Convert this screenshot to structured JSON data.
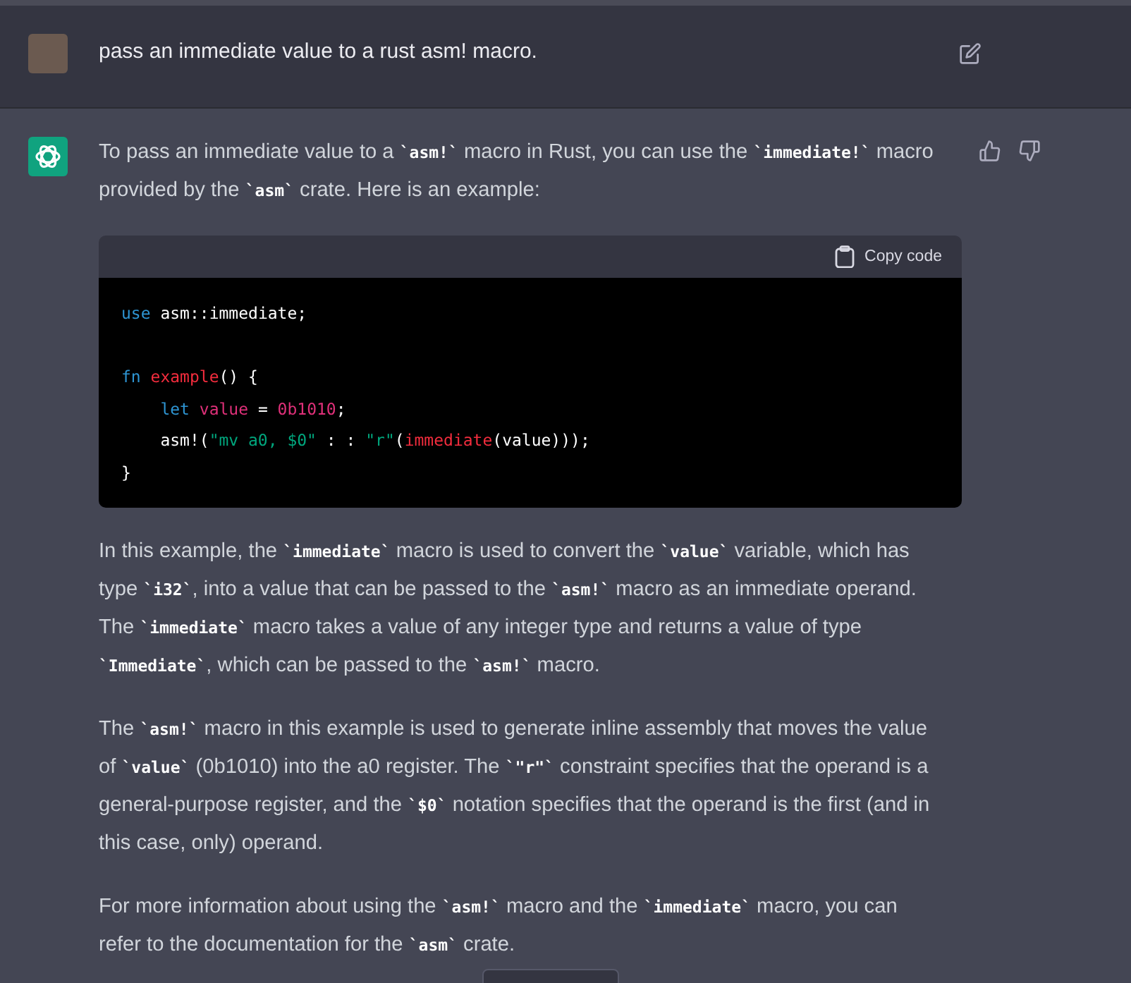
{
  "user_message": {
    "text": "pass an immediate value to a rust asm! macro."
  },
  "assistant_message": {
    "paragraphs_before": [
      [
        {
          "kind": "text",
          "text": "To pass an immediate value to a "
        },
        {
          "kind": "code",
          "text": "`asm!`"
        },
        {
          "kind": "text",
          "text": " macro in Rust, you can use the "
        },
        {
          "kind": "code",
          "text": "`immediate!`"
        },
        {
          "kind": "text",
          "text": " macro provided by the "
        },
        {
          "kind": "code",
          "text": "`asm`"
        },
        {
          "kind": "text",
          "text": " crate. Here is an example:"
        }
      ]
    ],
    "code_block": {
      "copy_label": "Copy code",
      "blocks": [
        {
          "lines": [
            {
              "tokens": [
                {
                  "kind": "keyword",
                  "text": "use"
                },
                {
                  "kind": "plain",
                  "text": " asm::immediate;"
                }
              ]
            }
          ]
        },
        {
          "lines": [
            {
              "tokens": [
                {
                  "kind": "keyword",
                  "text": "fn"
                },
                {
                  "kind": "function",
                  "text": " example"
                },
                {
                  "kind": "plain",
                  "text": "() {"
                }
              ],
              "children": [
                {
                  "tokens": [
                    {
                      "kind": "keyword",
                      "text": "let"
                    },
                    {
                      "kind": "variable",
                      "text": " value"
                    },
                    {
                      "kind": "plain",
                      "text": " = "
                    },
                    {
                      "kind": "number",
                      "text": "0b1010"
                    },
                    {
                      "kind": "plain",
                      "text": ";"
                    }
                  ]
                },
                {
                  "tokens": [
                    {
                      "kind": "plain",
                      "text": "asm!("
                    },
                    {
                      "kind": "string",
                      "text": "\"mv a0, $0\""
                    },
                    {
                      "kind": "plain",
                      "text": " : : "
                    },
                    {
                      "kind": "string",
                      "text": "\"r\""
                    },
                    {
                      "kind": "plain",
                      "text": "("
                    },
                    {
                      "kind": "function",
                      "text": "immediate"
                    },
                    {
                      "kind": "plain",
                      "text": "(value)));"
                    }
                  ]
                }
              ]
            },
            {
              "tokens": [
                {
                  "kind": "plain",
                  "text": "}"
                }
              ]
            }
          ]
        }
      ]
    },
    "paragraphs_after": [
      [
        {
          "kind": "text",
          "text": "In this example, the "
        },
        {
          "kind": "code",
          "text": "`immediate`"
        },
        {
          "kind": "text",
          "text": " macro is used to convert the "
        },
        {
          "kind": "code",
          "text": "`value`"
        },
        {
          "kind": "text",
          "text": " variable, which has type "
        },
        {
          "kind": "code",
          "text": "`i32`"
        },
        {
          "kind": "text",
          "text": ", into a value that can be passed to the "
        },
        {
          "kind": "code",
          "text": "`asm!`"
        },
        {
          "kind": "text",
          "text": " macro as an immediate operand. The "
        },
        {
          "kind": "code",
          "text": "`immediate`"
        },
        {
          "kind": "text",
          "text": " macro takes a value of any integer type and returns a value of type "
        },
        {
          "kind": "code",
          "text": "`Immediate`"
        },
        {
          "kind": "text",
          "text": ", which can be passed to the "
        },
        {
          "kind": "code",
          "text": "`asm!`"
        },
        {
          "kind": "text",
          "text": " macro."
        }
      ],
      [
        {
          "kind": "text",
          "text": "The "
        },
        {
          "kind": "code",
          "text": "`asm!`"
        },
        {
          "kind": "text",
          "text": " macro in this example is used to generate inline assembly that moves the value of "
        },
        {
          "kind": "code",
          "text": "`value`"
        },
        {
          "kind": "text",
          "text": " (0b1010) into the a0 register. The "
        },
        {
          "kind": "code",
          "text": "`\"r\"`"
        },
        {
          "kind": "text",
          "text": " constraint specifies that the operand is a general-purpose register, and the "
        },
        {
          "kind": "code",
          "text": "`$0`"
        },
        {
          "kind": "text",
          "text": " notation specifies that the operand is the first (and in this case, only) operand."
        }
      ],
      [
        {
          "kind": "text",
          "text": "For more information about using the "
        },
        {
          "kind": "code",
          "text": "`asm!`"
        },
        {
          "kind": "text",
          "text": " macro and the "
        },
        {
          "kind": "code",
          "text": "`immediate`"
        },
        {
          "kind": "text",
          "text": " macro, you can refer to the documentation for the "
        },
        {
          "kind": "code",
          "text": "`asm`"
        },
        {
          "kind": "text",
          "text": " crate."
        }
      ]
    ]
  }
}
